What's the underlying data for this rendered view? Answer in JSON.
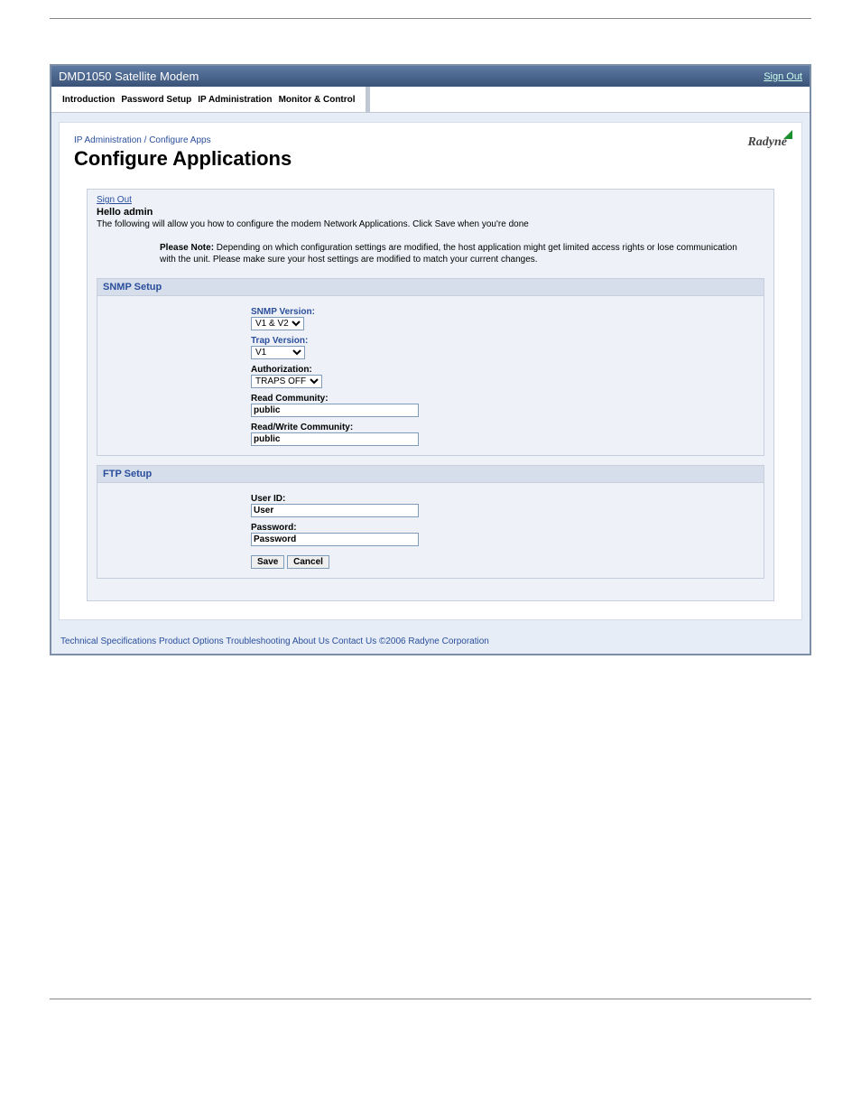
{
  "titlebar": {
    "product": "DMD1050 Satellite Modem",
    "signout": "Sign Out"
  },
  "nav": {
    "items": [
      "Introduction",
      "Password Setup",
      "IP Administration",
      "Monitor & Control"
    ]
  },
  "header": {
    "breadcrumb": "IP Administration / Configure Apps",
    "title": "Configure Applications",
    "logo": "Radyne"
  },
  "panel": {
    "signout": "Sign Out",
    "hello": "Hello admin",
    "intro": "The following will allow you how to configure the modem Network Applications. Click Save when you're done",
    "note_prefix": "Please Note:",
    "note_body": " Depending on which configuration settings are modified, the host application might get limited access rights or lose communication with the unit. Please make sure your host settings are modified to match your current changes."
  },
  "snmp": {
    "section": "SNMP Setup",
    "version_label": "SNMP Version:",
    "version_value": "V1 & V2",
    "trap_label": "Trap Version:",
    "trap_value": "V1",
    "auth_label": "Authorization:",
    "auth_value": "TRAPS OFF",
    "readcomm_label": "Read Community:",
    "readcomm_value": "public",
    "rwcomm_label": "Read/Write Community:",
    "rwcomm_value": "public"
  },
  "ftp": {
    "section": "FTP Setup",
    "userid_label": "User ID:",
    "userid_value": "User",
    "password_label": "Password:",
    "password_value": "Password"
  },
  "buttons": {
    "save": "Save",
    "cancel": "Cancel"
  },
  "footer": {
    "text": "Technical Specifications  Product Options  Troubleshooting  About Us  Contact Us  ©2006 Radyne Corporation"
  }
}
